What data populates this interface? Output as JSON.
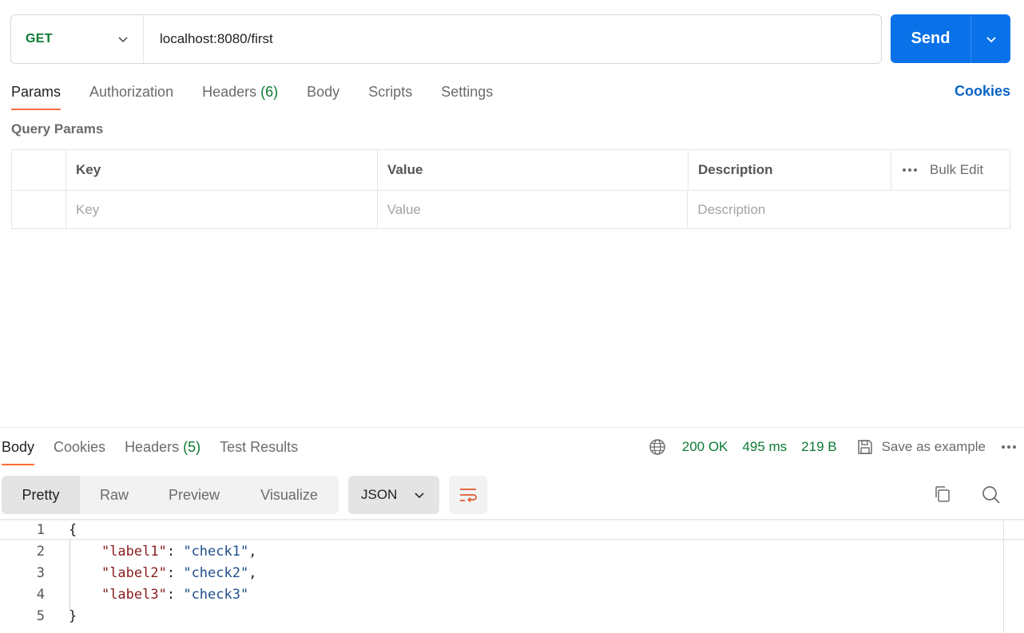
{
  "request": {
    "method": "GET",
    "url": "localhost:8080/first",
    "send_label": "Send"
  },
  "request_tabs": {
    "params": "Params",
    "authorization": "Authorization",
    "headers": "Headers",
    "headers_count": "(6)",
    "body": "Body",
    "scripts": "Scripts",
    "settings": "Settings",
    "cookies": "Cookies"
  },
  "query_params": {
    "title": "Query Params",
    "columns": {
      "key": "Key",
      "value": "Value",
      "description": "Description"
    },
    "bulk_edit": "Bulk Edit",
    "placeholders": {
      "key": "Key",
      "value": "Value",
      "description": "Description"
    }
  },
  "response_tabs": {
    "body": "Body",
    "cookies": "Cookies",
    "headers": "Headers",
    "headers_count": "(5)",
    "test_results": "Test Results"
  },
  "response_meta": {
    "status": "200 OK",
    "time": "495 ms",
    "size": "219 B",
    "save_as_example": "Save as example"
  },
  "view_modes": {
    "pretty": "Pretty",
    "raw": "Raw",
    "preview": "Preview",
    "visualize": "Visualize",
    "format": "JSON"
  },
  "code": {
    "line_numbers": [
      "1",
      "2",
      "3",
      "4",
      "5"
    ],
    "lines": [
      {
        "key": "\"label1\"",
        "value": "\"check1\"",
        "trail": ","
      },
      {
        "key": "\"label2\"",
        "value": "\"check2\"",
        "trail": ","
      },
      {
        "key": "\"label3\"",
        "value": "\"check3\"",
        "trail": ""
      }
    ],
    "open": "{",
    "close": "}"
  },
  "colors": {
    "accent": "#0a72e8",
    "method": "#0b7a33",
    "tab_underline": "#ff6c37",
    "json_key": "#8a1c1c",
    "json_string": "#1f4e8c"
  }
}
